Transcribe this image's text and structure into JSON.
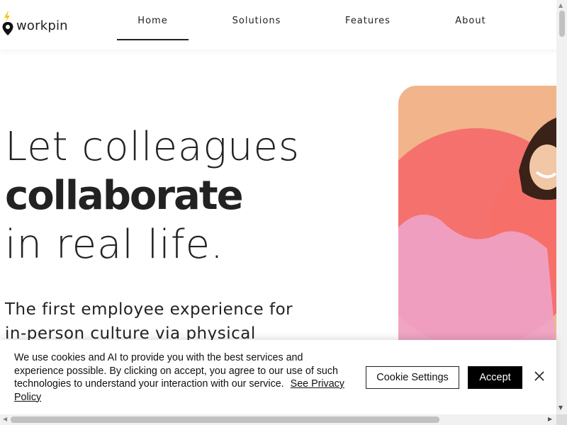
{
  "brand": {
    "name": "workpin",
    "icon": "location-pin-bolt-icon",
    "accent": "#f5c518"
  },
  "nav": {
    "items": [
      {
        "label": "Home",
        "active": true
      },
      {
        "label": "Solutions",
        "active": false
      },
      {
        "label": "Features",
        "active": false
      },
      {
        "label": "About",
        "active": false
      }
    ]
  },
  "hero": {
    "line1": "Let colleagues",
    "line2": "collaborate",
    "line3": "in real life.",
    "subtitle": "The first employee experience for in-person culture via physical"
  },
  "cookie": {
    "text": "We use cookies and AI to provide you with the best services and experience possible. By clicking on accept, you agree to our use of such technologies to understand your interaction with our service.",
    "link": "See Privacy Policy",
    "settings_label": "Cookie Settings",
    "accept_label": "Accept",
    "close_icon": "close-icon"
  },
  "colors": {
    "text": "#222222",
    "accept_bg": "#000000",
    "hero_bg": "#f2b48a",
    "blob_coral": "#f56b6b",
    "blob_orange": "#f5a24a"
  }
}
